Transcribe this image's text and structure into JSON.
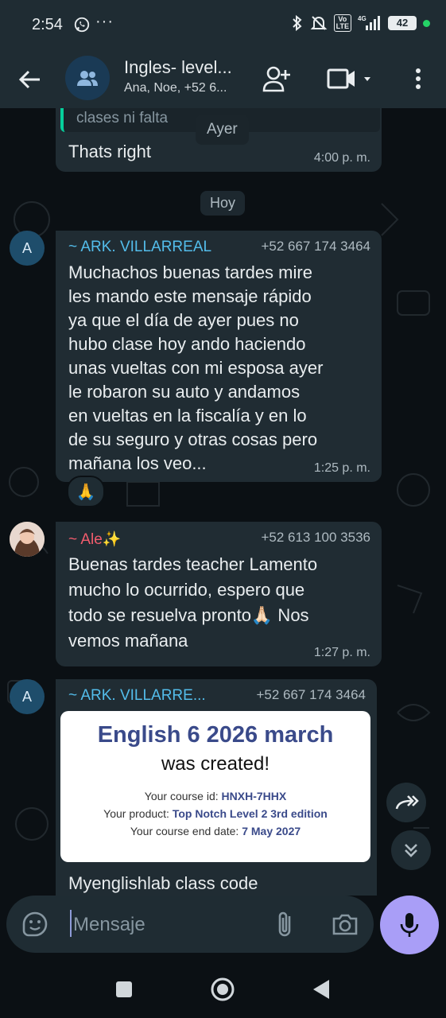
{
  "status_bar": {
    "time": "2:54",
    "overflow_dots": "···",
    "volte_label": "Vo\nLTE",
    "network": "4G",
    "battery": "42"
  },
  "header": {
    "title": "Ingles- level...",
    "subtitle": "Ana, Noe, +52 6..."
  },
  "chat": {
    "quoted_snippet": "clases ni falta",
    "floating_date": "Ayer",
    "msg1": {
      "text": "Thats right",
      "time": "4:00 p. m."
    },
    "date_separator": "Hoy",
    "msg2": {
      "avatar_letter": "A",
      "sender": "~ ARK. VILLARREAL",
      "phone": "+52 667 174 3464",
      "lines": [
        "Muchachos buenas tardes mire",
        "les mando este mensaje rápido",
        "ya que el día de ayer pues no",
        "hubo clase hoy ando haciendo",
        "unas vueltas con mi esposa ayer",
        "le robaron su auto y andamos",
        "en vueltas en la fiscalía y en lo",
        "de su seguro y otras cosas pero",
        "mañana los veo..."
      ],
      "time": "1:25 p. m.",
      "reaction": "🙏"
    },
    "msg3": {
      "sender": "~ Ale✨",
      "phone": "+52 613 100 3536",
      "lines": [
        "Buenas tardes teacher Lamento",
        "mucho lo ocurrido, espero que",
        "todo se resuelva pronto🙏🏻 Nos",
        "vemos mañana"
      ],
      "time": "1:27 p. m."
    },
    "msg4": {
      "avatar_letter": "A",
      "sender": "~ ARK. VILLARRE...",
      "phone": "+52 667 174 3464",
      "card": {
        "title": "English 6 2026 march",
        "subtitle": "was created!",
        "course_id_label": "Your course id:",
        "course_id": "HNXH-7HHX",
        "product_label": "Your product:",
        "product": "Top Notch Level 2 3rd edition",
        "end_label": "Your course end date:",
        "end_date": "7 May 2027"
      },
      "text": "Myenglishlab class code"
    }
  },
  "input": {
    "placeholder": "Mensaje"
  },
  "colors": {
    "header_bg": "#1f2c33",
    "bubble_bg": "#202c33",
    "sender_ark": "#53bdeb",
    "sender_ale": "#f15c6d",
    "mic_bg": "#a99ef7",
    "card_title": "#3a4a8a"
  }
}
